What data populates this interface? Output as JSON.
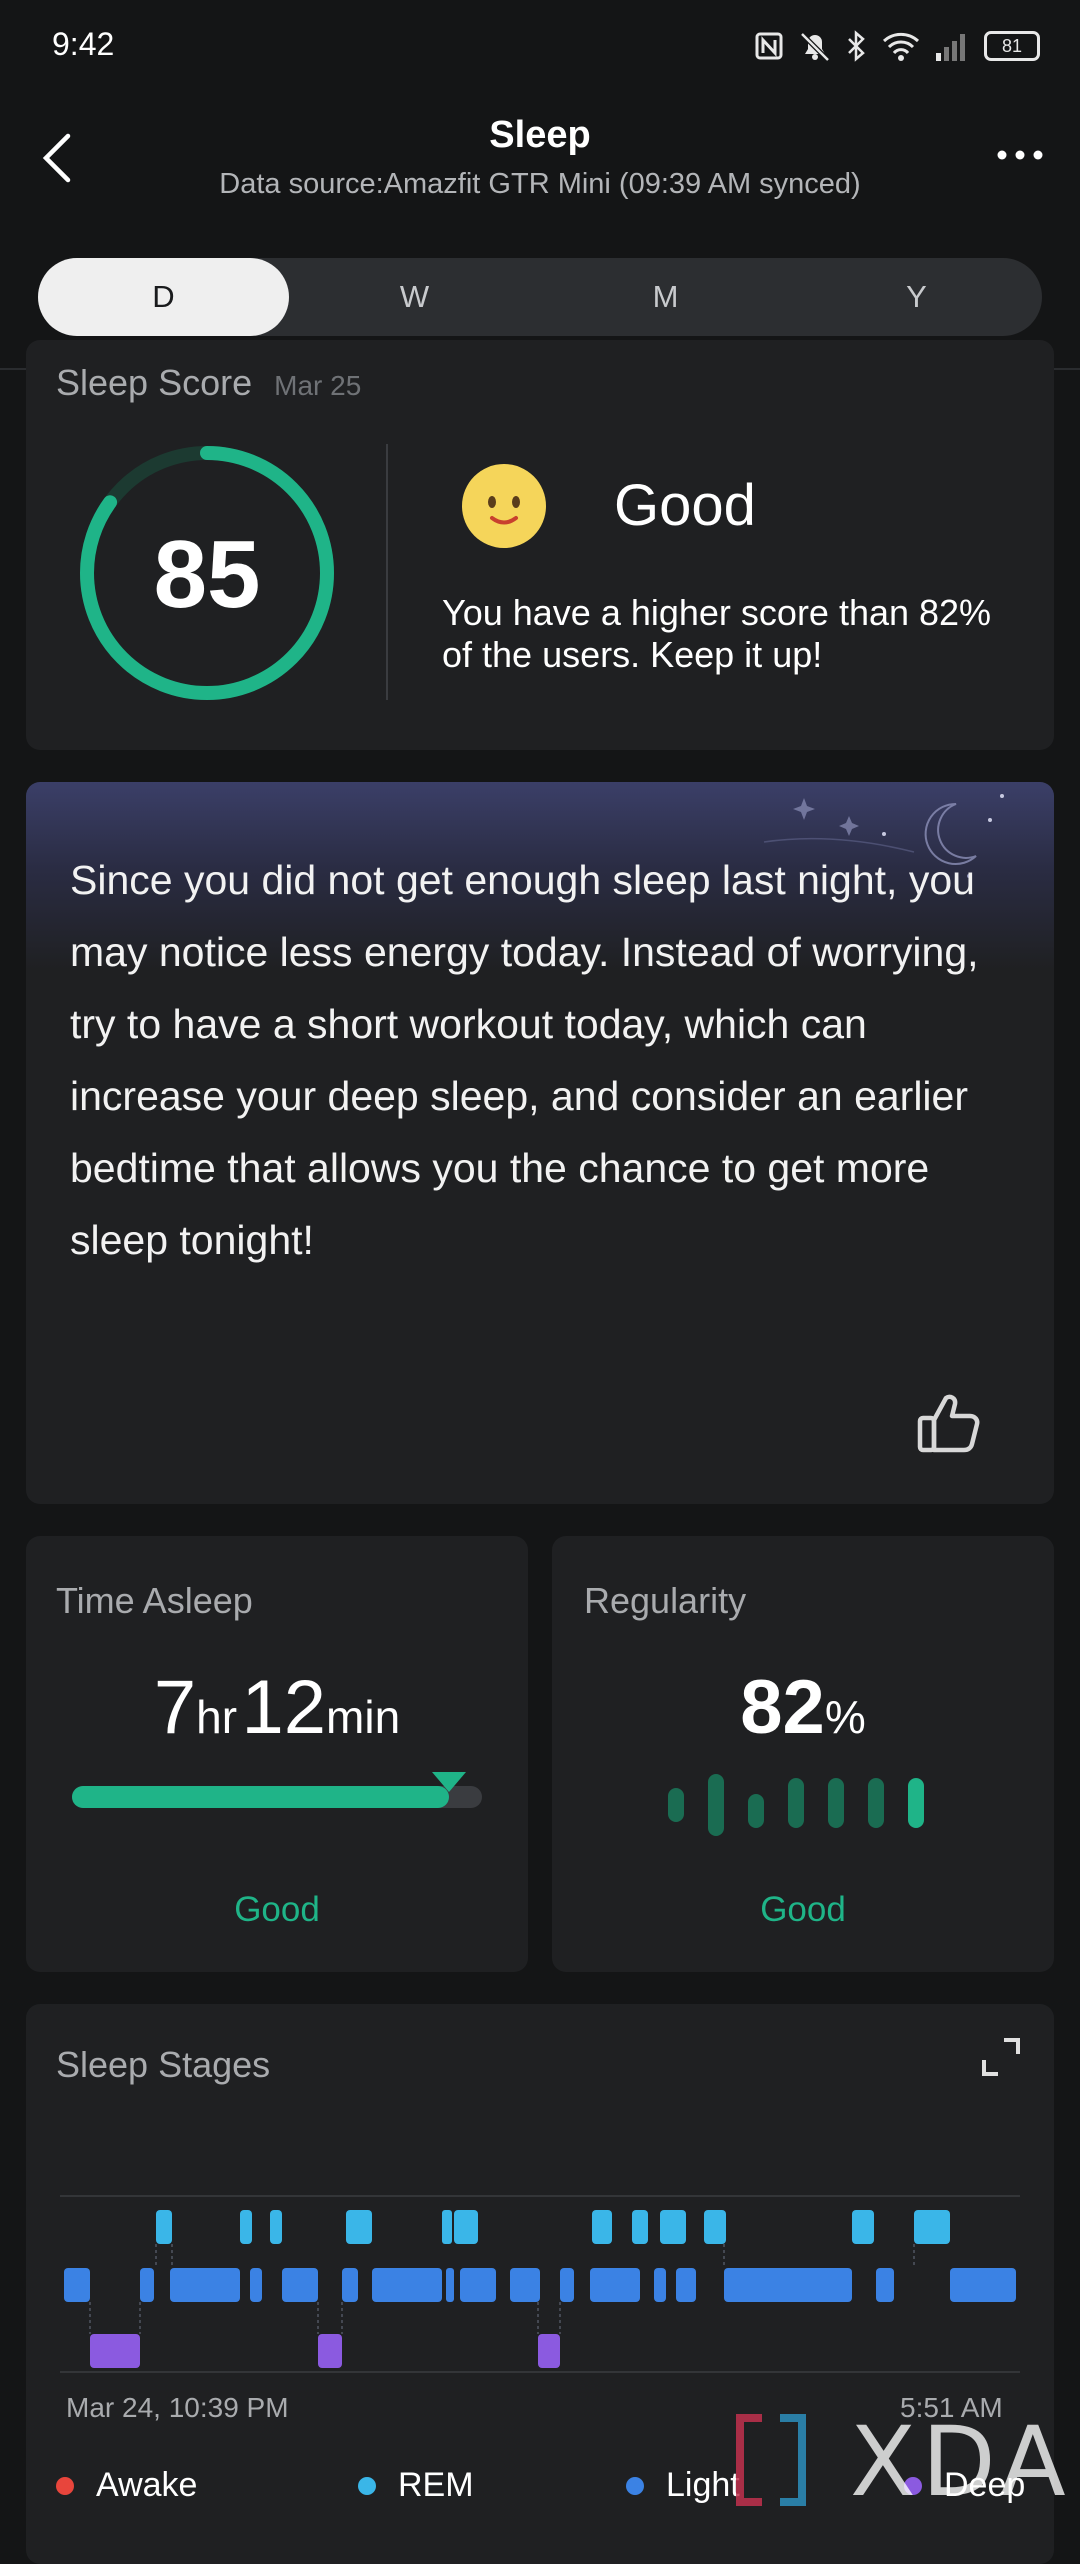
{
  "status": {
    "time": "9:42",
    "battery": "81"
  },
  "header": {
    "title": "Sleep",
    "subtitle": "Data source:Amazfit GTR Mini (09:39 AM synced)"
  },
  "tabs": [
    {
      "label": "D",
      "active": true
    },
    {
      "label": "W",
      "active": false
    },
    {
      "label": "M",
      "active": false
    },
    {
      "label": "Y",
      "active": false
    }
  ],
  "score_card": {
    "label": "Sleep Score",
    "date": "Mar 25",
    "score": "85",
    "score_value": 85,
    "rating": "Good",
    "description": "You have a higher score than 82% of the users. Keep it up!"
  },
  "tip": {
    "text": "Since you did not get enough sleep last night, you may notice less energy today. Instead of worrying, try to have a short workout today, which can increase your deep sleep, and consider an earlier bedtime that allows you the chance to get more sleep tonight!"
  },
  "time_asleep": {
    "label": "Time Asleep",
    "hours": "7",
    "hours_unit": "hr",
    "minutes": "12",
    "minutes_unit": "min",
    "progress": 0.92,
    "rating": "Good"
  },
  "regularity": {
    "label": "Regularity",
    "value": "82",
    "unit": "%",
    "rating": "Good"
  },
  "stages": {
    "label": "Sleep Stages",
    "start": "Mar 24, 10:39 PM",
    "end": "5:51 AM",
    "legend": [
      {
        "name": "Awake",
        "color": "#e8453c"
      },
      {
        "name": "REM",
        "color": "#3ab6e8"
      },
      {
        "name": "Light",
        "color": "#3b82e4"
      },
      {
        "name": "Deep",
        "color": "#8b5ae0"
      }
    ]
  },
  "colors": {
    "accent": "#1fb488",
    "rem": "#3ab6e8",
    "light": "#3b82e4",
    "deep": "#8b5ae0",
    "awake": "#e8453c"
  },
  "watermark": "XDA"
}
